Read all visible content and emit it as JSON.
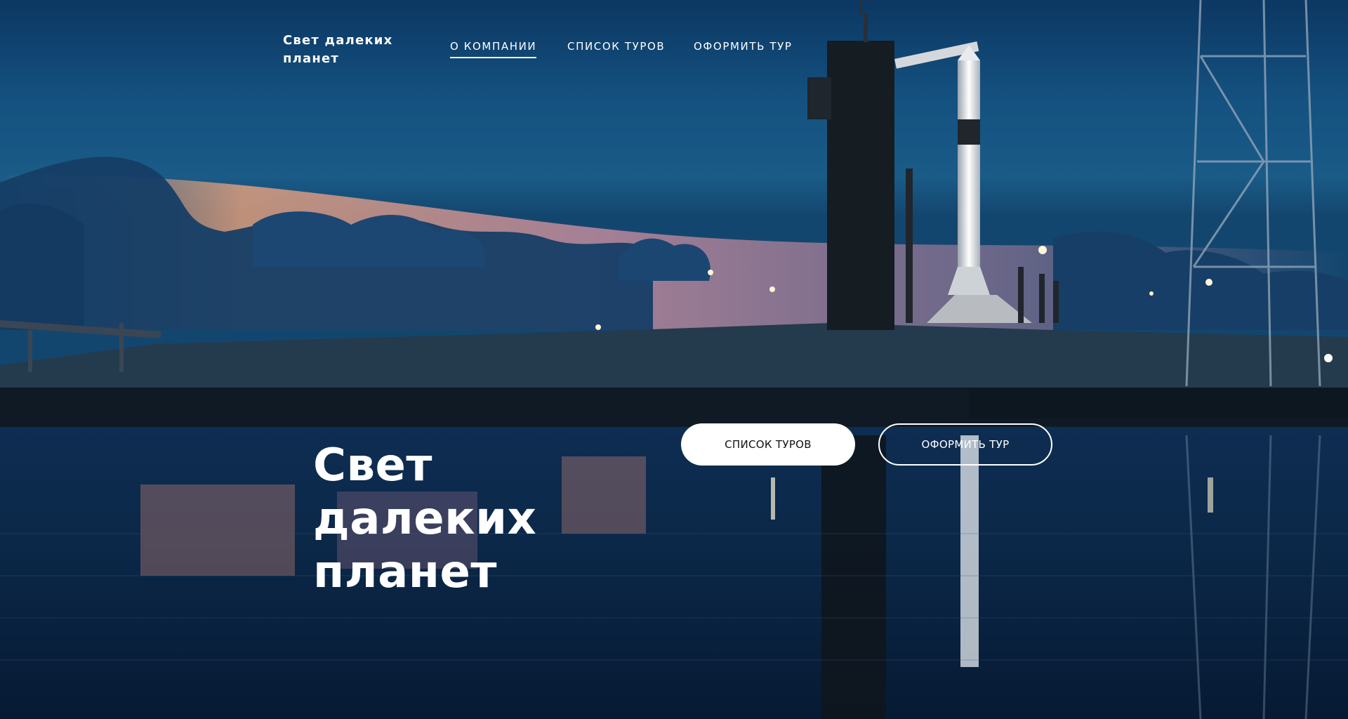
{
  "brand": {
    "name": "Свет далеких планет"
  },
  "nav": {
    "items": [
      {
        "label": "О КОМПАНИИ",
        "active": true
      },
      {
        "label": "СПИСОК ТУРОВ",
        "active": false
      },
      {
        "label": "ОФОРМИТЬ ТУР",
        "active": false
      }
    ]
  },
  "hero": {
    "title": "Свет далеких планет",
    "primary_button": "СПИСОК ТУРОВ",
    "secondary_button": "ОФОРМИТЬ ТУР",
    "background": "rocket-launch-pad-at-dusk-image"
  },
  "colors": {
    "text": "#ffffff",
    "sky_top": "#0e3a63",
    "sky_mid": "#1d5a86",
    "sunset": "#f0a07a",
    "water": "#0a2442"
  }
}
